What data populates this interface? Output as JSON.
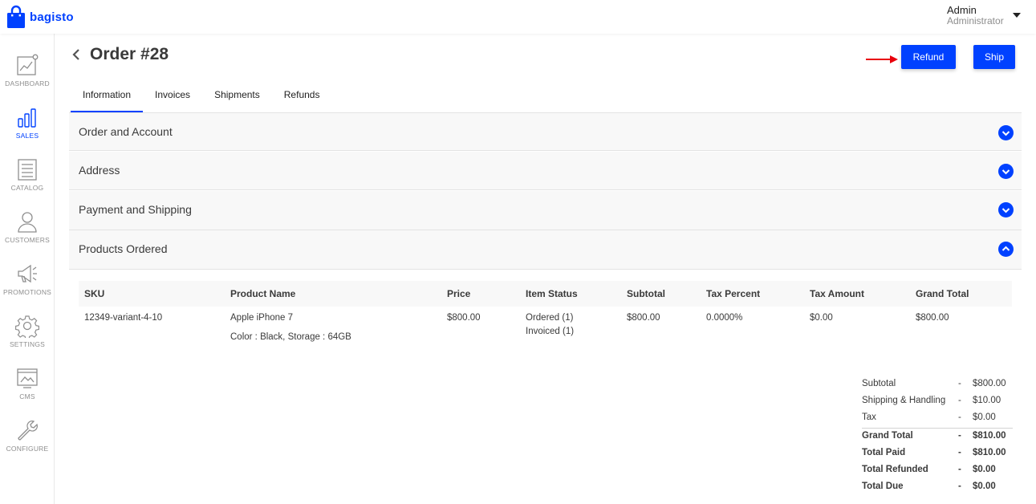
{
  "brand": {
    "name": "bagisto",
    "accent": "#0041ff"
  },
  "user": {
    "name": "Admin",
    "role": "Administrator"
  },
  "sidebar": {
    "items": [
      {
        "label": "DASHBOARD",
        "icon": "dashboard-icon"
      },
      {
        "label": "SALES",
        "icon": "sales-icon",
        "active": true
      },
      {
        "label": "CATALOG",
        "icon": "catalog-icon"
      },
      {
        "label": "CUSTOMERS",
        "icon": "customers-icon"
      },
      {
        "label": "PROMOTIONS",
        "icon": "promotions-icon"
      },
      {
        "label": "SETTINGS",
        "icon": "settings-icon"
      },
      {
        "label": "CMS",
        "icon": "cms-icon"
      },
      {
        "label": "CONFIGURE",
        "icon": "configure-icon"
      }
    ]
  },
  "page": {
    "title": "Order #28"
  },
  "actions": {
    "refund_label": "Refund",
    "ship_label": "Ship"
  },
  "tabs": [
    {
      "label": "Information",
      "active": true
    },
    {
      "label": "Invoices"
    },
    {
      "label": "Shipments"
    },
    {
      "label": "Refunds"
    }
  ],
  "sections": [
    {
      "title": "Order and Account",
      "expanded": false
    },
    {
      "title": "Address",
      "expanded": false
    },
    {
      "title": "Payment and Shipping",
      "expanded": false
    },
    {
      "title": "Products Ordered",
      "expanded": true
    }
  ],
  "products": {
    "columns": [
      "SKU",
      "Product Name",
      "Price",
      "Item Status",
      "Subtotal",
      "Tax Percent",
      "Tax Amount",
      "Grand Total"
    ],
    "rows": [
      {
        "sku": "12349-variant-4-10",
        "name": "Apple iPhone 7",
        "options": "Color : Black, Storage : 64GB",
        "price": "$800.00",
        "status_ordered": "Ordered (1)",
        "status_invoiced": "Invoiced (1)",
        "subtotal": "$800.00",
        "tax_percent": "0.0000%",
        "tax_amount": "$0.00",
        "grand_total": "$800.00"
      }
    ]
  },
  "summary": [
    {
      "label": "Subtotal",
      "value": "$800.00",
      "bold": false
    },
    {
      "label": "Shipping & Handling",
      "value": "$10.00",
      "bold": false
    },
    {
      "label": "Tax",
      "value": "$0.00",
      "bold": false
    },
    {
      "label": "Grand Total",
      "value": "$810.00",
      "bold": true
    },
    {
      "label": "Total Paid",
      "value": "$810.00",
      "bold": true
    },
    {
      "label": "Total Refunded",
      "value": "$0.00",
      "bold": true
    },
    {
      "label": "Total Due",
      "value": "$0.00",
      "bold": true
    }
  ],
  "summary_separator": "-",
  "annotation_color": "#e8000b"
}
